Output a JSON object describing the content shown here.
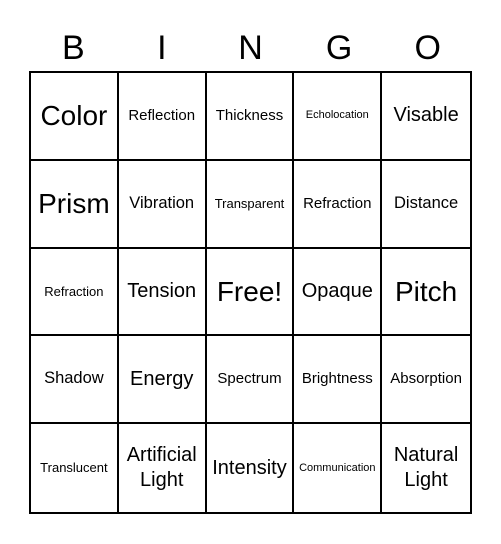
{
  "header": [
    "B",
    "I",
    "N",
    "G",
    "O"
  ],
  "cells": [
    [
      "Color",
      "Reflection",
      "Thickness",
      "Echolocation",
      "Visable"
    ],
    [
      "Prism",
      "Vibration",
      "Transparent",
      "Refraction",
      "Distance"
    ],
    [
      "Refraction",
      "Tension",
      "Free!",
      "Opaque",
      "Pitch"
    ],
    [
      "Shadow",
      "Energy",
      "Spectrum",
      "Brightness",
      "Absorption"
    ],
    [
      "Translucent",
      "Artificial Light",
      "Intensity",
      "Communication",
      "Natural Light"
    ]
  ]
}
